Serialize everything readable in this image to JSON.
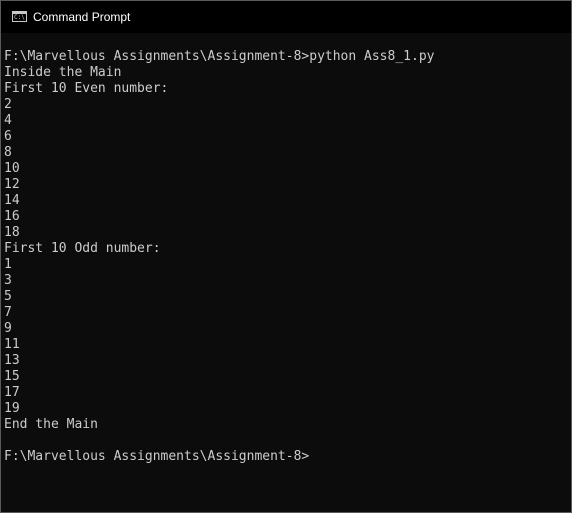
{
  "window": {
    "title": "Command Prompt",
    "icon": "cmd-app-icon",
    "icon_glyph": "C:\\"
  },
  "console": {
    "lines": [
      "",
      "F:\\Marvellous Assignments\\Assignment-8>python Ass8_1.py",
      "Inside the Main",
      "First 10 Even number:",
      "2",
      "4",
      "6",
      "8",
      "10",
      "12",
      "14",
      "16",
      "18",
      "First 10 Odd number:",
      "1",
      "3",
      "5",
      "7",
      "9",
      "11",
      "13",
      "15",
      "17",
      "19",
      "End the Main",
      "",
      "F:\\Marvellous Assignments\\Assignment-8>"
    ]
  },
  "colors": {
    "background": "#0c0c0c",
    "text": "#cccccc",
    "title_text": "#ffffff"
  }
}
